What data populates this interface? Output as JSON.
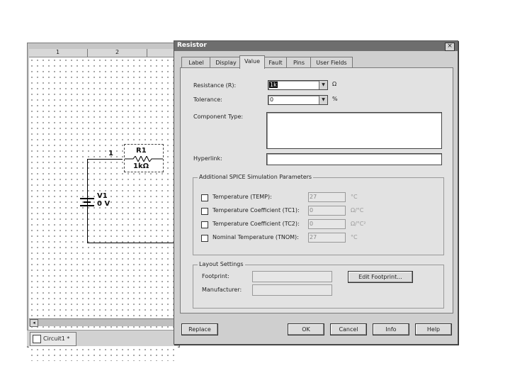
{
  "schematic": {
    "ruler_numbers": [
      "1",
      "2"
    ],
    "scroll_left": "◂",
    "tab_label": "Circuit1 *",
    "r1_ref": "R1",
    "r1_value": "1kΩ",
    "v1_ref": "V1",
    "v1_value": "0 V",
    "node_label": "1"
  },
  "dialog": {
    "title": "Resistor",
    "close_symbol": "×",
    "tabs": [
      "Label",
      "Display",
      "Value",
      "Fault",
      "Pins",
      "User Fields"
    ],
    "active_tab": "Value",
    "resistance": {
      "label": "Resistance (R):",
      "value": "1k",
      "unit": "Ω",
      "arrow": "▼"
    },
    "tolerance": {
      "label": "Tolerance:",
      "value": "0",
      "unit": "%",
      "arrow": "▼"
    },
    "component_type": {
      "label": "Component Type:",
      "value": ""
    },
    "hyperlink": {
      "label": "Hyperlink:",
      "value": ""
    },
    "spice": {
      "title": "Additional SPICE Simulation Parameters",
      "params": [
        {
          "label": "Temperature (TEMP):",
          "value": "27",
          "unit": "°C",
          "checked": false
        },
        {
          "label": "Temperature Coefficient (TC1):",
          "value": "0",
          "unit": "Ω/°C",
          "checked": false
        },
        {
          "label": "Temperature Coefficient (TC2):",
          "value": "0",
          "unit": "Ω/°C²",
          "checked": false
        },
        {
          "label": "Nominal Temperature (TNOM):",
          "value": "27",
          "unit": "°C",
          "checked": false
        }
      ]
    },
    "layout": {
      "title": "Layout Settings",
      "footprint_label": "Footprint:",
      "footprint_value": "",
      "manufacturer_label": "Manufacturer:",
      "manufacturer_value": "",
      "edit_button": "Edit Footprint..."
    },
    "buttons": {
      "replace": "Replace",
      "ok": "OK",
      "cancel": "Cancel",
      "info": "Info",
      "help": "Help"
    }
  }
}
